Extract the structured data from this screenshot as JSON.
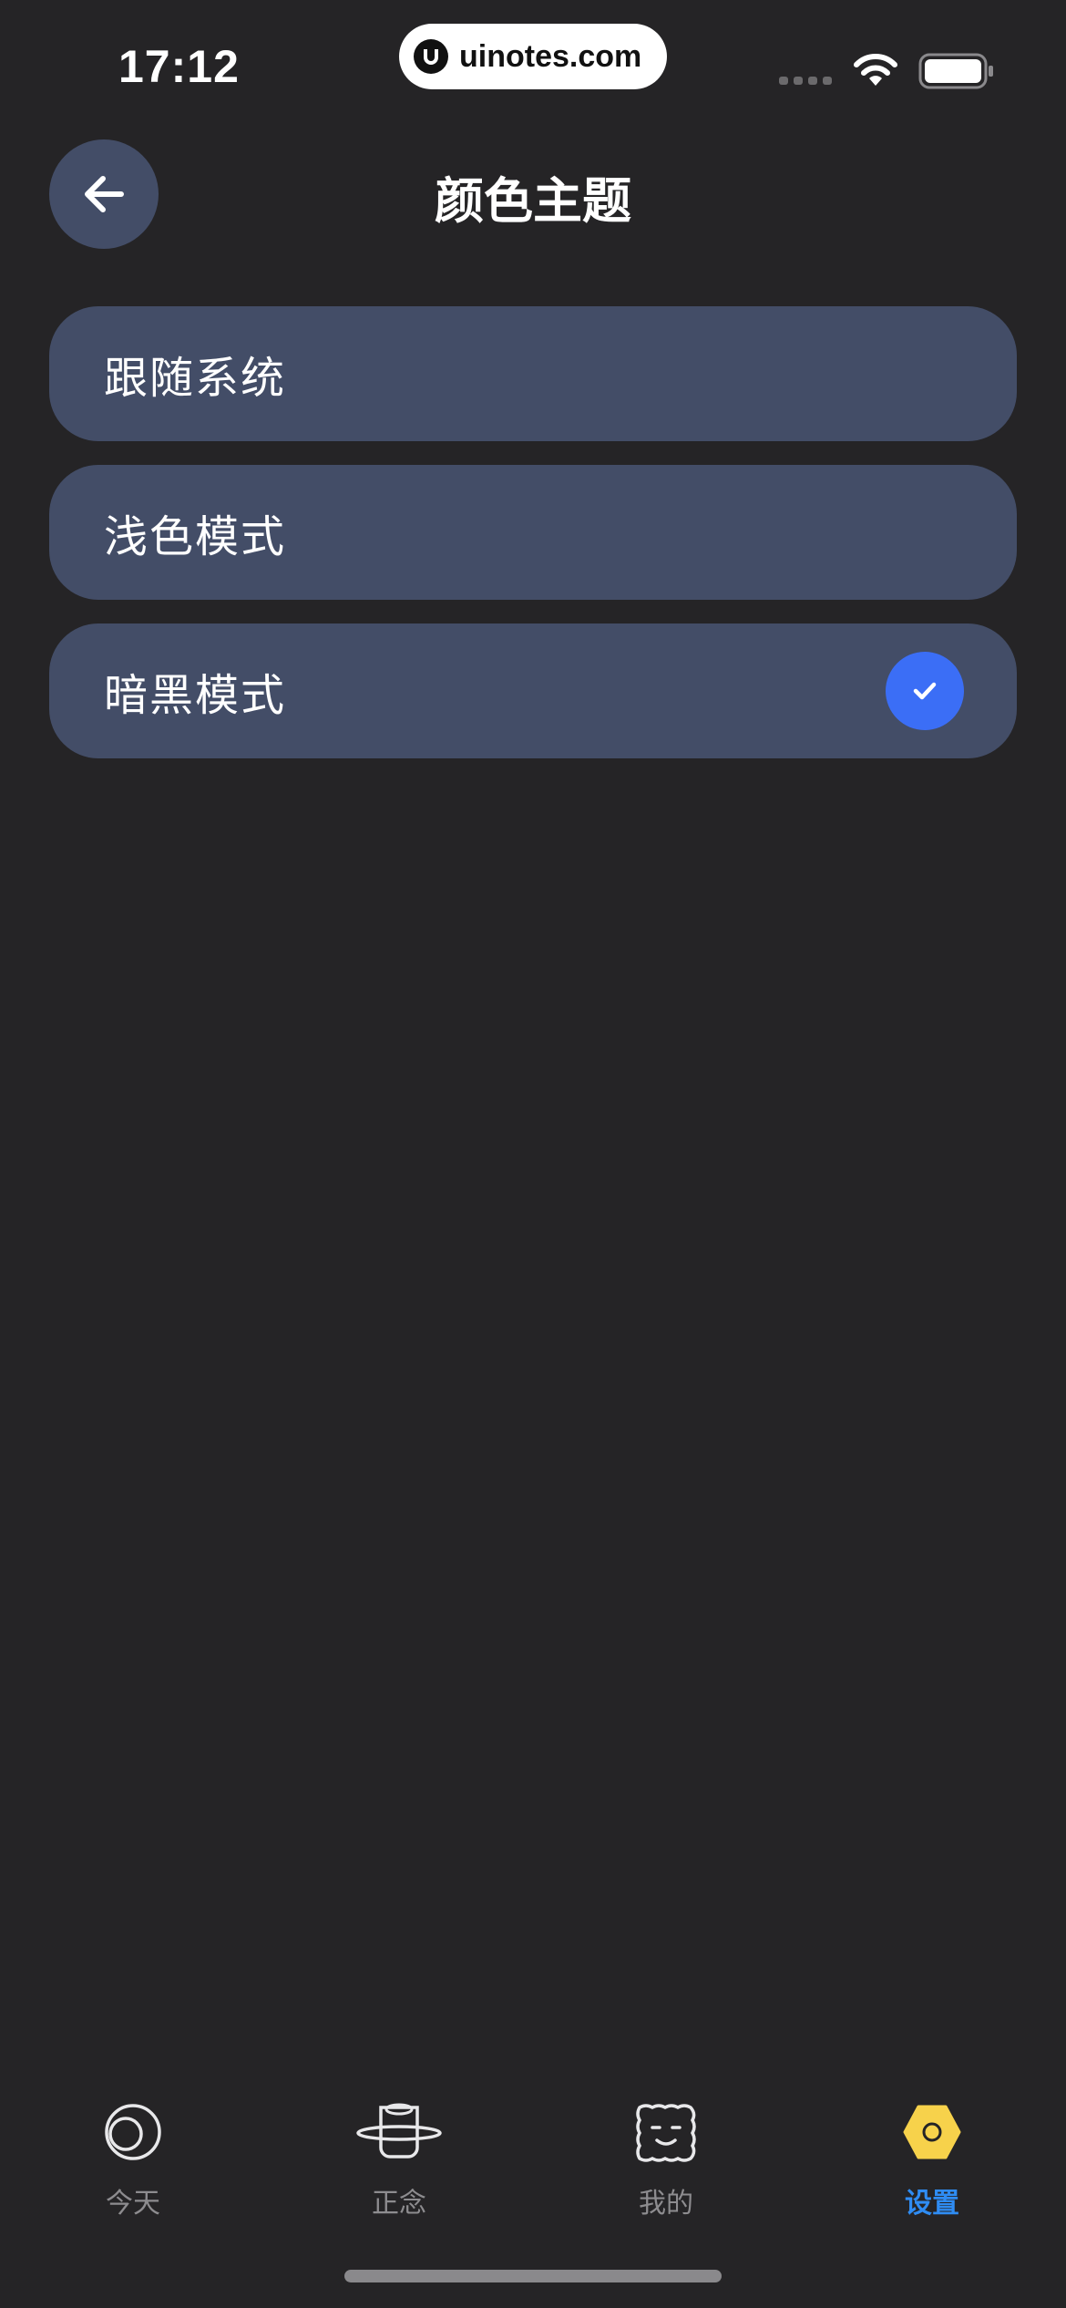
{
  "status_bar": {
    "time": "17:12",
    "watermark": "uinotes.com"
  },
  "header": {
    "title": "颜色主题",
    "back_icon": "arrow-left-icon"
  },
  "options": [
    {
      "label": "跟随系统",
      "selected": false
    },
    {
      "label": "浅色模式",
      "selected": false
    },
    {
      "label": "暗黑模式",
      "selected": true
    }
  ],
  "tabbar": {
    "tabs": [
      {
        "label": "今天",
        "icon": "moon-circle-icon",
        "active": false
      },
      {
        "label": "正念",
        "icon": "planet-icon",
        "active": false
      },
      {
        "label": "我的",
        "icon": "smiley-square-icon",
        "active": false
      },
      {
        "label": "设置",
        "icon": "hexagon-icon",
        "active": true
      }
    ]
  },
  "colors": {
    "background": "#252426",
    "card": "#434d67",
    "accent": "#3b6ef6",
    "active_tab": "#2f8cf3",
    "settings_icon": "#f7d24b"
  }
}
